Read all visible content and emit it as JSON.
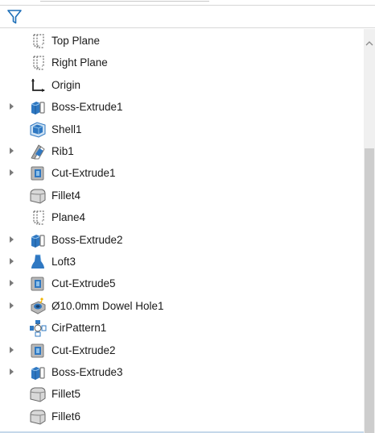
{
  "feature_tree": {
    "items": [
      {
        "label": "Top Plane",
        "icon": "plane-icon",
        "expandable": false
      },
      {
        "label": "Right Plane",
        "icon": "plane-icon",
        "expandable": false
      },
      {
        "label": "Origin",
        "icon": "origin-icon",
        "expandable": false
      },
      {
        "label": "Boss-Extrude1",
        "icon": "boss-extrude-icon",
        "expandable": true
      },
      {
        "label": "Shell1",
        "icon": "shell-icon",
        "expandable": false
      },
      {
        "label": "Rib1",
        "icon": "rib-icon",
        "expandable": true
      },
      {
        "label": "Cut-Extrude1",
        "icon": "cut-extrude-icon",
        "expandable": true
      },
      {
        "label": "Fillet4",
        "icon": "fillet-icon",
        "expandable": false
      },
      {
        "label": "Plane4",
        "icon": "plane-icon",
        "expandable": false
      },
      {
        "label": "Boss-Extrude2",
        "icon": "boss-extrude-icon",
        "expandable": true
      },
      {
        "label": "Loft3",
        "icon": "loft-icon",
        "expandable": true
      },
      {
        "label": "Cut-Extrude5",
        "icon": "cut-extrude-icon",
        "expandable": true
      },
      {
        "label": "Ø10.0mm Dowel Hole1",
        "icon": "hole-wizard-icon",
        "expandable": true
      },
      {
        "label": "CirPattern1",
        "icon": "circular-pattern-icon",
        "expandable": false
      },
      {
        "label": "Cut-Extrude2",
        "icon": "cut-extrude-icon",
        "expandable": true
      },
      {
        "label": "Boss-Extrude3",
        "icon": "boss-extrude-icon",
        "expandable": true
      },
      {
        "label": "Fillet5",
        "icon": "fillet-icon",
        "expandable": false
      },
      {
        "label": "Fillet6",
        "icon": "fillet-icon",
        "expandable": false
      }
    ]
  },
  "filter": {
    "icon": "filter-icon"
  },
  "colors": {
    "accent_blue": "#1d6fb8",
    "gray_feature": "#8a9098",
    "expander": "#7a7a7a"
  }
}
